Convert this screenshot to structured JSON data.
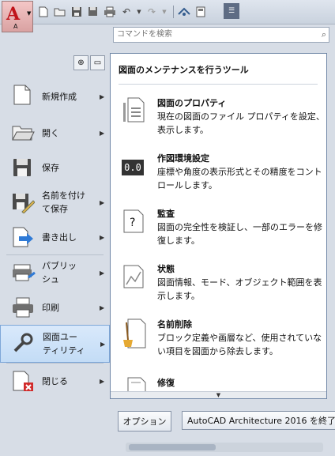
{
  "app": {
    "letter": "A"
  },
  "search": {
    "placeholder": "コマンドを検索"
  },
  "menu": {
    "items": [
      {
        "label": "新規作成",
        "icon": "new-file-icon"
      },
      {
        "label": "開く",
        "icon": "open-folder-icon"
      },
      {
        "label": "保存",
        "icon": "save-disk-icon"
      },
      {
        "label": "名前を付け\nて保存",
        "icon": "save-as-icon"
      },
      {
        "label": "書き出し",
        "icon": "export-icon"
      },
      {
        "label": "パブリッ\nシュ",
        "icon": "publish-icon"
      },
      {
        "label": "印刷",
        "icon": "printer-icon"
      },
      {
        "label": "図面ユー\nティリティ",
        "icon": "wrench-icon"
      },
      {
        "label": "閉じる",
        "icon": "close-file-icon"
      }
    ]
  },
  "panel": {
    "header": "図面のメンテナンスを行うツール",
    "entries": [
      {
        "title": "図面のプロパティ",
        "desc": "現在の図面のファイル プロパティを設定、表示します。",
        "icon": "properties-icon"
      },
      {
        "title": "作図環境設定",
        "desc": "座標や角度の表示形式とその精度をコントロールします。",
        "icon_text": "0.0"
      },
      {
        "title": "監査",
        "desc": "図面の完全性を検証し、一部のエラーを修復します。",
        "icon_text": "?"
      },
      {
        "title": "状態",
        "desc": "図面情報、モード、オブジェクト範囲を表示します。",
        "icon": "status-icon"
      },
      {
        "title": "名前削除",
        "desc": "ブロック定義や画層など、使用されていない項目を図面から除去します。",
        "icon": "purge-broom-icon"
      },
      {
        "title": "修復",
        "desc": "",
        "icon": "recover-icon"
      }
    ]
  },
  "footer": {
    "options_label": "オプション",
    "exit_label": "AutoCAD Architecture 2016 を終了"
  }
}
